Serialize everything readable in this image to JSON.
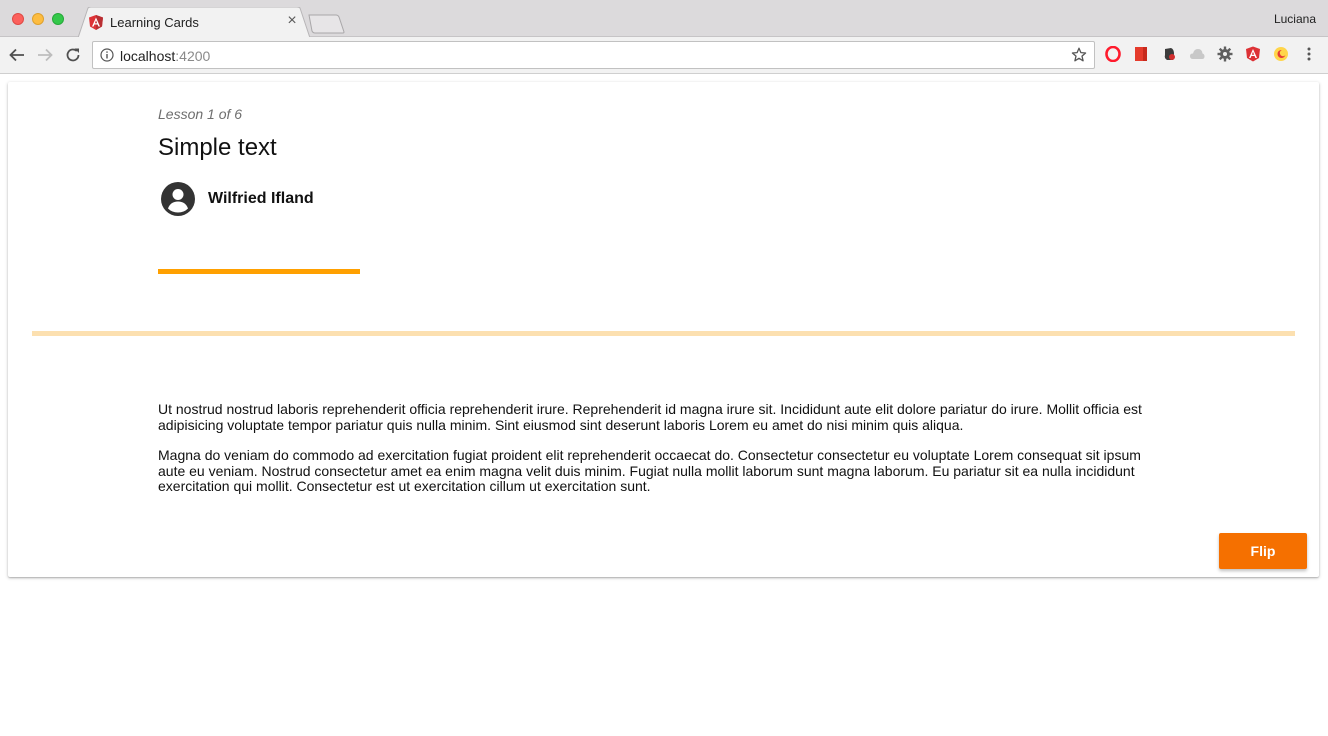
{
  "browser": {
    "tab": {
      "title": "Learning Cards",
      "close_glyph": "×"
    },
    "profile_name": "Luciana",
    "url": {
      "host": "localhost",
      "port": ":4200"
    },
    "extensions": [
      "opera-icon",
      "red-book-icon",
      "evernote-icon",
      "cloud-icon",
      "gear-extension-icon",
      "angular-icon",
      "moon-icon",
      "more-icon"
    ]
  },
  "card": {
    "lesson_counter": "Lesson 1 of 6",
    "title": "Simple text",
    "author": "Wilfried Ifland",
    "progress_fraction": 0.167,
    "paragraphs": [
      "Ut nostrud nostrud laboris reprehenderit officia reprehenderit irure. Reprehenderit id magna irure sit. Incididunt aute elit dolore pariatur do irure. Mollit officia est adipisicing voluptate tempor pariatur quis nulla minim. Sint eiusmod sint deserunt laboris Lorem eu amet do nisi minim quis aliqua.",
      "Magna do veniam do commodo ad exercitation fugiat proident elit reprehenderit occaecat do. Consectetur consectetur eu voluptate Lorem consequat sit ipsum aute eu veniam. Nostrud consectetur amet ea enim magna velit duis minim. Fugiat nulla mollit laborum sunt magna laborum. Eu pariatur sit ea nulla incididunt exercitation qui mollit. Consectetur est ut exercitation cillum ut exercitation sunt."
    ],
    "flip_label": "Flip"
  },
  "colors": {
    "accent": "#f57000",
    "progress": "#ffa000",
    "divider": "#fce0b0"
  }
}
